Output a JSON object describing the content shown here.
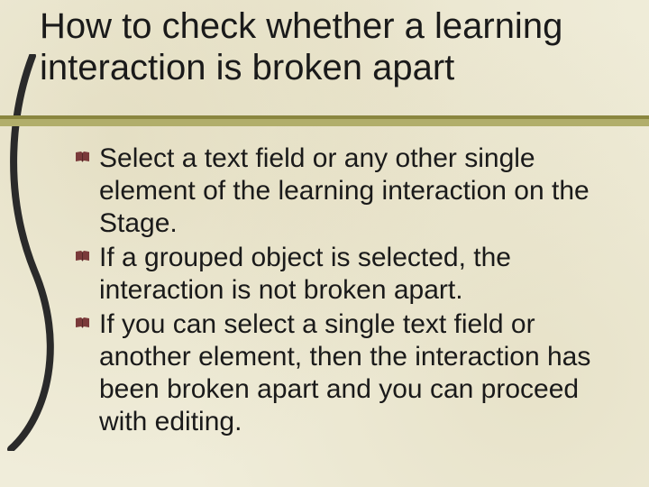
{
  "title": "How to check whether a learning interaction is broken apart",
  "bullets": [
    "Select a text field or any other single element of the learning interaction on the Stage.",
    "If a grouped object is selected, the interaction is not broken apart.",
    "If you can select a single text field or another element, then the interaction has been broken apart and you can proceed with editing."
  ],
  "colors": {
    "rule": "#9a9750",
    "bullet": "#7a3a3a",
    "bg": "#f0edda"
  },
  "icons": {
    "bullet": "book-icon"
  }
}
